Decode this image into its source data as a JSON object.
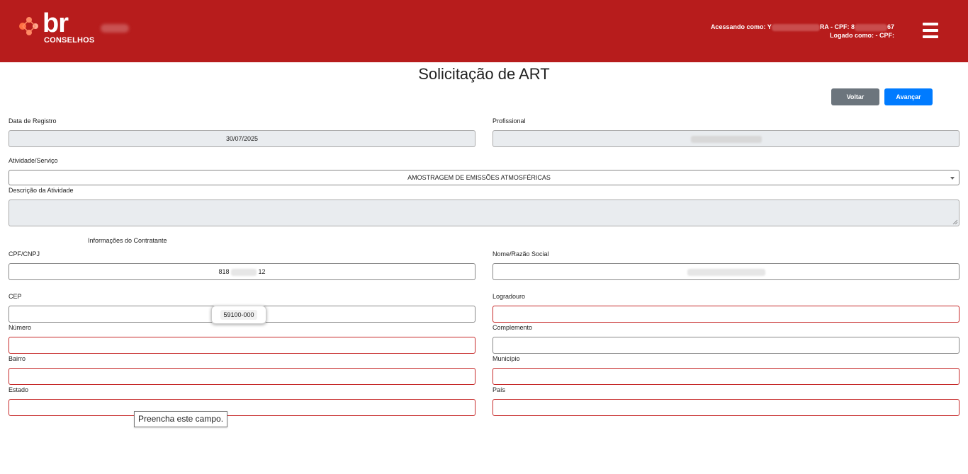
{
  "header": {
    "logo_text": "br",
    "logo_subtext": "CONSELHOS",
    "user_line1_prefix": "Acessando como: Y",
    "user_line1_middle": "RA - CPF: 8",
    "user_line1_suffix": "67",
    "user_line2": "Logado como: - CPF:",
    "brand_color": "#b71c1c"
  },
  "page": {
    "title": "Solicitação de ART"
  },
  "actions": {
    "back_label": "Voltar",
    "next_label": "Avançar"
  },
  "form": {
    "data_registro": {
      "label": "Data de Registro",
      "value": "30/07/2025"
    },
    "profissional": {
      "label": "Profissional",
      "value": ""
    },
    "atividade": {
      "label": "Atividade/Serviço",
      "value": "AMOSTRAGEM DE EMISSÕES ATMOSFÉRICAS"
    },
    "descricao": {
      "label": "Descrição da Atividade",
      "value": ""
    },
    "contratante_section": "Informações do Contratante",
    "cpf_cnpj": {
      "label": "CPF/CNPJ",
      "value_prefix": "818",
      "value_suffix": "12"
    },
    "nome_razao": {
      "label": "Nome/Razão Social",
      "value": ""
    },
    "cep": {
      "label": "CEP",
      "value": "59100-000"
    },
    "logradouro": {
      "label": "Logradouro",
      "value": ""
    },
    "numero": {
      "label": "Número",
      "value": ""
    },
    "complemento": {
      "label": "Complemento",
      "value": ""
    },
    "bairro": {
      "label": "Bairro",
      "value": ""
    },
    "municipio": {
      "label": "Município",
      "value": ""
    },
    "estado": {
      "label": "Estado",
      "value": ""
    },
    "pais": {
      "label": "País",
      "value": ""
    }
  },
  "validation_tooltip": "Preencha este campo.",
  "icons": {
    "menu": "hamburger-menu-icon",
    "dropdown": "chevron-down-icon"
  }
}
